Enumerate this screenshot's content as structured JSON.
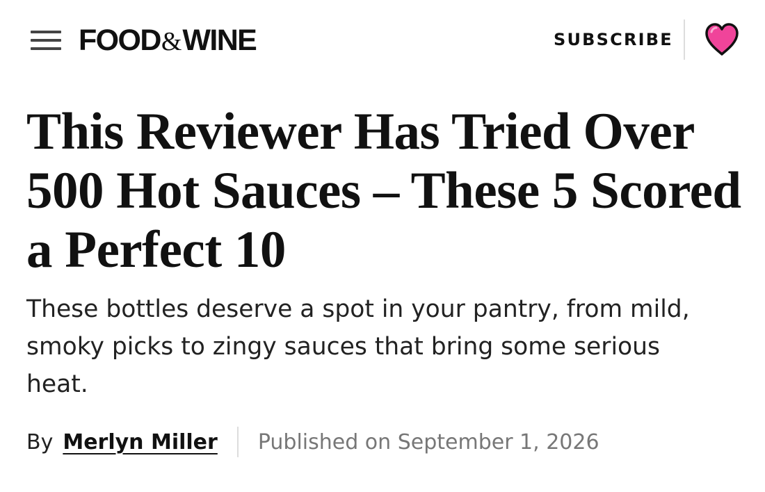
{
  "header": {
    "logo_left": "FOOD",
    "logo_amp": "&",
    "logo_right": "WINE",
    "subscribe_label": "SUBSCRIBE",
    "menu_icon": "hamburger-menu-icon",
    "heart_icon": "heart-icon"
  },
  "article": {
    "title": "This Reviewer Has Tried Over 500 Hot Sauces – These 5 Scored a Perfect 10",
    "subtitle": "These bottles deserve a spot in your pantry, from mild, smoky picks to zingy sauces that bring some serious heat.",
    "byline_prefix": "By",
    "author": "Merlyn Miller",
    "published": "Published on September 1, 2026"
  },
  "colors": {
    "text": "#111111",
    "muted": "#777777",
    "divider": "#dddddd",
    "heart_fill": "#f0449a",
    "heart_outline": "#111111"
  }
}
